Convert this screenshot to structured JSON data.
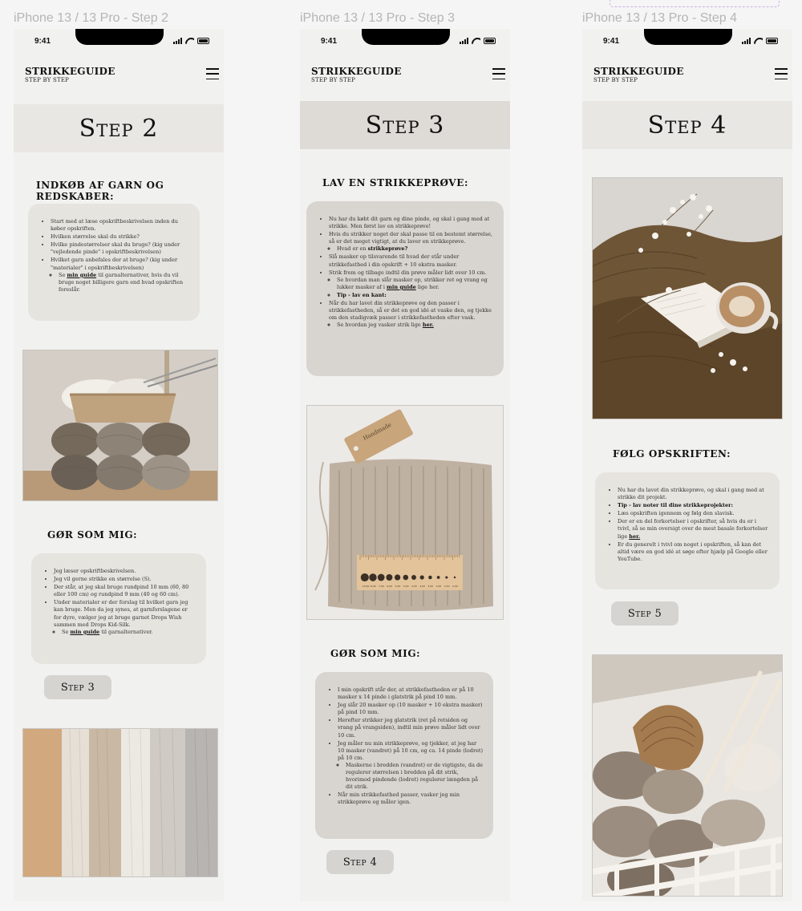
{
  "frames": [
    {
      "label": "iPhone 13 / 13 Pro - Step 2",
      "time": "9:41",
      "logo_title": "STRIKKEGUIDE",
      "logo_sub": "STEP BY STEP",
      "step_title": "Step 2",
      "section1": "INDKØB AF GARN OG REDSKABER:",
      "card1": [
        "Start med at læse opskriftbeskrivelsen inden du køber opskriften.",
        "Hvilken størrelse skal du strikke?",
        "Hvilke pindestørrelser skal du bruge? (kig under \"vejledende pinde\" i opskriftbeskrivelsen)",
        "Hvilket garn anbefales der at bruge? (kig under \"materialer\" i opskriftbeskrivelsen)"
      ],
      "card1_sub": {
        "pre": "Se ",
        "link": "min guide",
        "post": " til garnalternativer, hvis du vil bruge noget billigere garn end hvad opskriften foreslår."
      },
      "section2": "GØR SOM MIG:",
      "card2": [
        "Jeg læser opskriftbeskrivelsen.",
        "Jeg vil gerne strikke en størrelse (S).",
        "Der står, at jeg skal bruge rundpind 10 mm (60, 80 eller 100 cm) og rundpind 9 mm (40 og 60 cm).",
        "Under materialer er der forslag til hvilket garn jeg kan bruge. Men da jeg synes, at garnforslagene er for dyre, vælger jeg at bruge garnet Drops Wish sammen med Drops Kid-Silk."
      ],
      "card2_sub": {
        "pre": "Se ",
        "link": "min guide",
        "post": " til garnalternativer."
      },
      "button": "Step 3"
    },
    {
      "label": "iPhone 13 / 13 Pro - Step 3",
      "time": "9:41",
      "logo_title": "STRIKKEGUIDE",
      "logo_sub": "STEP BY STEP",
      "step_title": "Step 3",
      "section1": "LAV EN STRIKKEPRØVE:",
      "card1_a": [
        "Nu har du købt dit garn og dine pinde, og skal i gang med at strikke. Men først lav en strikkeprøve!",
        "Hvis du strikker noget der skal passe til en bestemt størrelse, så er det meget vigtigt, at du laver en strikkeprøve."
      ],
      "card1_what": {
        "pre": "Hvad er en ",
        "bold": "strikkeprøve?"
      },
      "card1_b": [
        "Slå masker op tilsvarende til hvad der står under strikkefasthed i din opskrift + 10 ekstra masker.",
        "Strik frem og tilbage indtil din prøve måler lidt over 10 cm."
      ],
      "card1_how": {
        "pre": "Se hvordan man slår masker op, strikker ret og vrang og lukker masker af i ",
        "link": "min guide",
        "post": " lige her."
      },
      "card1_tip": "Tip - lav en kant:",
      "card1_c": "Når du har lavet din strikkeprøve og den passer i strikkefastheden, så er det en god idé at vaske den, og tjekke om den stadigvæk passer i strikkefastheden efter vask.",
      "card1_wash": {
        "pre": "Se hvordan jeg vasker strik lige ",
        "link": "her."
      },
      "section2": "GØR SOM MIG:",
      "card2_a": [
        "I min opskrift står der, at strikkefastheden er på 10 masker x 14 pinde i glatstrik på pind 10 mm.",
        "Jeg slår 20 masker op (10 masker + 10 ekstra masker) på pind 10 mm.",
        "Herefter strikker jeg glatstrik (ret på retsiden og vrang på vrangsiden), indtil min prøve måler lidt over 10 cm.",
        "Jeg måler nu min strikkeprøve, og tjekker, at jeg har 10 masker (vandret) på 10 cm, og ca. 14 pinde (lodret) på 10 cm."
      ],
      "card2_sub": "Maskerne i bredden (vandret) er de vigtigste, da de regulerer størrelsen i bredden på dit strik, hvorimod pindende (lodret) regulerer længden på dit strik.",
      "card2_b": "Når min strikkefasthed passer, vasker jeg min strikkeprøve og måler igen.",
      "button": "Step 4"
    },
    {
      "label": "iPhone 13 / 13 Pro - Step 4",
      "time": "9:41",
      "logo_title": "STRIKKEGUIDE",
      "logo_sub": "STEP BY STEP",
      "step_title": "Step 4",
      "section1": "FØLG OPSKRIFTEN:",
      "card1_a": "Nu har du lavet din strikkeprøve, og skal i gang med at strikke dit projekt.",
      "card1_tip": "Tip - lav noter til dine strikkeprojekter:",
      "card1_b": "Læs opskriften igennem og følg den slavisk.",
      "card1_c": {
        "pre": "Der er en del forkortelser i opskrifter, så hvis du er i tvivl, så se min oversigt over de mest basale forkortelser lige ",
        "link": "her."
      },
      "card1_d": "Er du generelt i tvivl om noget i opskriften, så kan det altid være en god idé at søge efter hjælp på Google eller YouTube.",
      "button": "Step 5"
    }
  ],
  "ruler_labels": [
    "2,00",
    "2,50",
    "3,00",
    "3,50",
    "4,00",
    "4,50",
    "5,00",
    "5,50",
    "6,00",
    "7,00",
    "8,00",
    "10,00"
  ],
  "tag_text": "Handmade"
}
